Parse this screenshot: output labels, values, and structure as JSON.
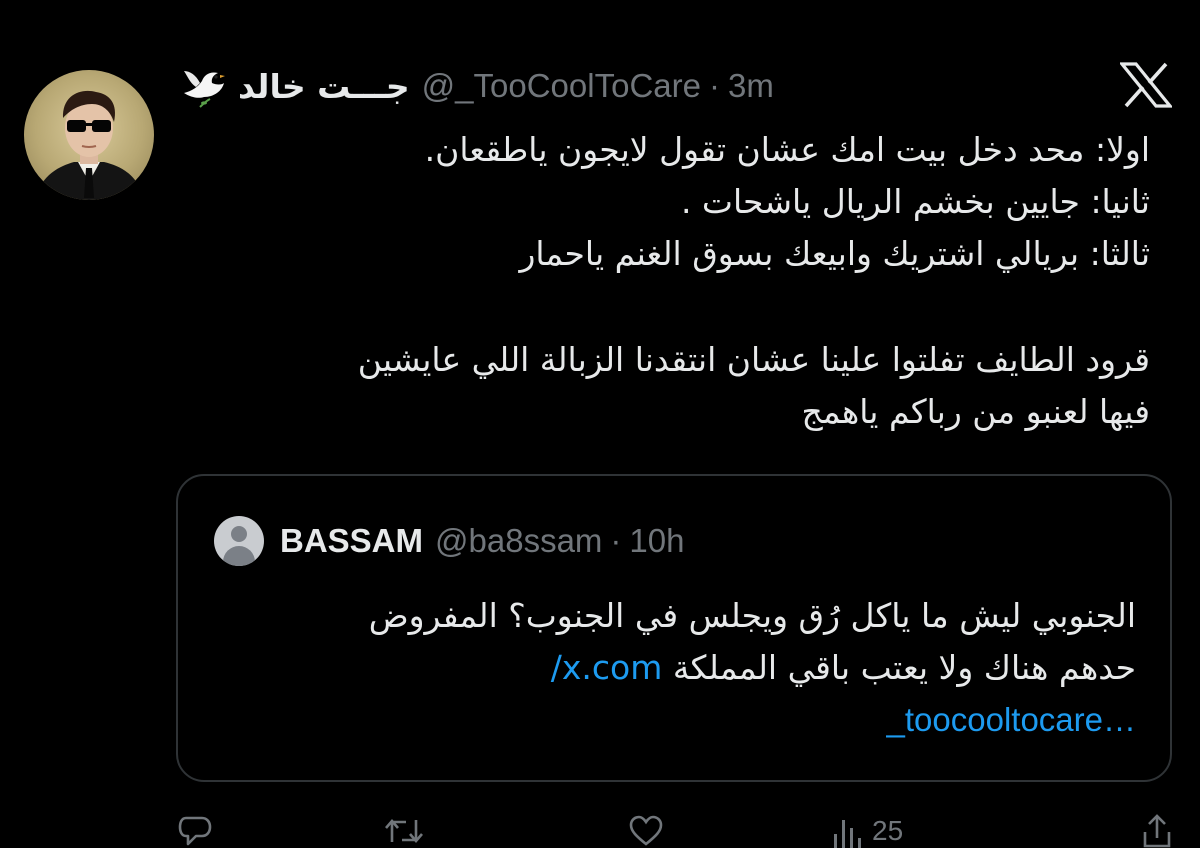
{
  "tweet": {
    "display_name": "جـــت خالد",
    "dove_emoji": "🕊️",
    "handle": "@_TooCoolToCare",
    "separator": "·",
    "time": "3m",
    "lines": [
      "اولا: محد دخل بيت امك عشان تقول لايجون ياطقعان.",
      "ثانيا: جايين بخشم الريال ياشحات .",
      "ثالثا: بريالي اشتريك وابيعك بسوق الغنم ياحمار",
      "",
      "قرود الطايف تفلتوا علينا عشان انتقدنا الزبالة اللي عايشين",
      "فيها لعنبو من رباكم ياهمج"
    ]
  },
  "quote": {
    "name": "BASSAM",
    "handle": "@ba8ssam",
    "separator": "·",
    "time": "10h",
    "line1": "الجنوبي ليش ما ياكل رُق ويجلس في الجنوب؟ المفروض",
    "line2_text": "حدهم هناك ولا يعتب باقي المملكة ",
    "line2_link": "x.com/",
    "line3_link": "_toocooltocare…"
  },
  "actions": {
    "reply_icon": "reply-icon",
    "retweet_icon": "retweet-icon",
    "like_icon": "like-icon",
    "views_icon": "views-icon",
    "views_count": "25",
    "share_icon": "share-icon"
  },
  "colors": {
    "background": "#000000",
    "text": "#e7e9ea",
    "muted": "#71767b",
    "link": "#1d9bf0",
    "border": "#2f3336"
  }
}
